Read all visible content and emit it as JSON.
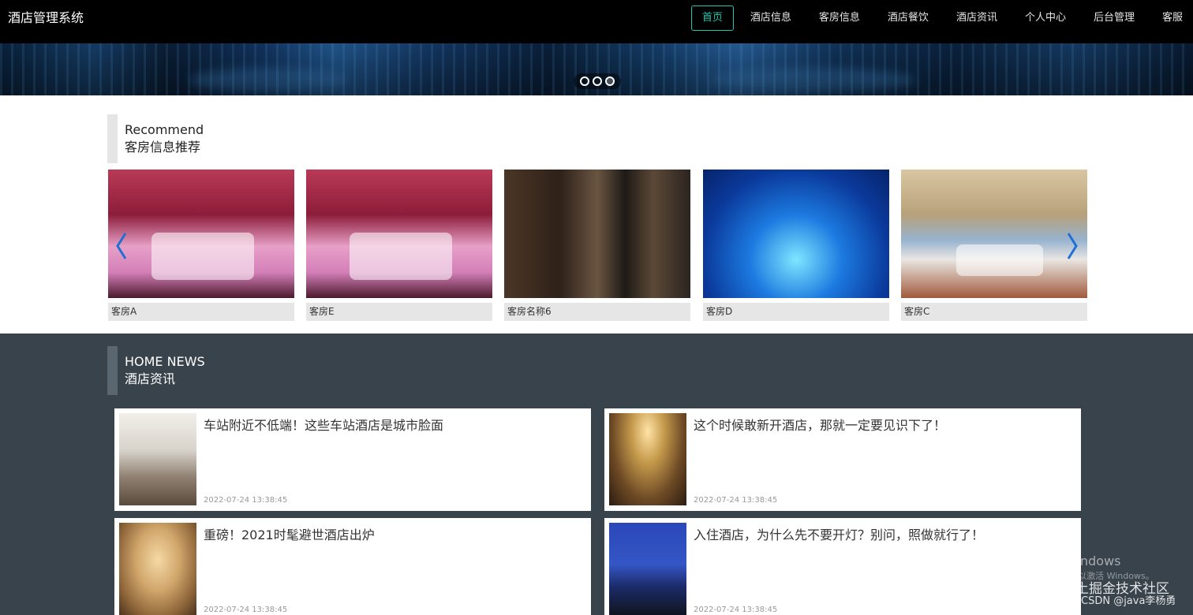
{
  "header": {
    "brand": "酒店管理系统",
    "nav": [
      {
        "label": "首页",
        "active": true
      },
      {
        "label": "酒店信息",
        "active": false
      },
      {
        "label": "客房信息",
        "active": false
      },
      {
        "label": "酒店餐饮",
        "active": false
      },
      {
        "label": "酒店资讯",
        "active": false
      },
      {
        "label": "个人中心",
        "active": false
      },
      {
        "label": "后台管理",
        "active": false
      },
      {
        "label": "客服",
        "active": false
      }
    ]
  },
  "banner": {
    "slide_count": 3,
    "active_slide": 3
  },
  "recommend": {
    "title_en": "Recommend",
    "title_cn": "客房信息推荐",
    "rooms": [
      {
        "name": "客房A"
      },
      {
        "name": "客房E"
      },
      {
        "name": "客房名称6"
      },
      {
        "name": "客房D"
      },
      {
        "name": "客房C"
      }
    ]
  },
  "news": {
    "title_en": "HOME NEWS",
    "title_cn": "酒店资讯",
    "items": [
      {
        "title": "车站附近不低端！这些车站酒店是城市脸面",
        "date": "2022-07-24 13:38:45"
      },
      {
        "title": "这个时候敢新开酒店，那就一定要见识下了！",
        "date": "2022-07-24 13:38:45"
      },
      {
        "title": "重磅！2021时髦避世酒店出炉",
        "date": "2022-07-24 13:38:45"
      },
      {
        "title": "入住酒店，为什么先不要开灯？别问，照做就行了！",
        "date": "2022-07-24 13:38:45"
      }
    ]
  },
  "watermark": {
    "activate_line1": "激活 Windows",
    "activate_line2": "转到\"设置\"以激活 Windows。",
    "community": "@稀土掘金技术社区",
    "csdn": "CSDN @java李杨勇"
  },
  "colors": {
    "nav_active": "#1fc8b0",
    "topbar_bg": "#000000",
    "news_bg": "#39434b",
    "arrow": "#1f6fd6"
  }
}
